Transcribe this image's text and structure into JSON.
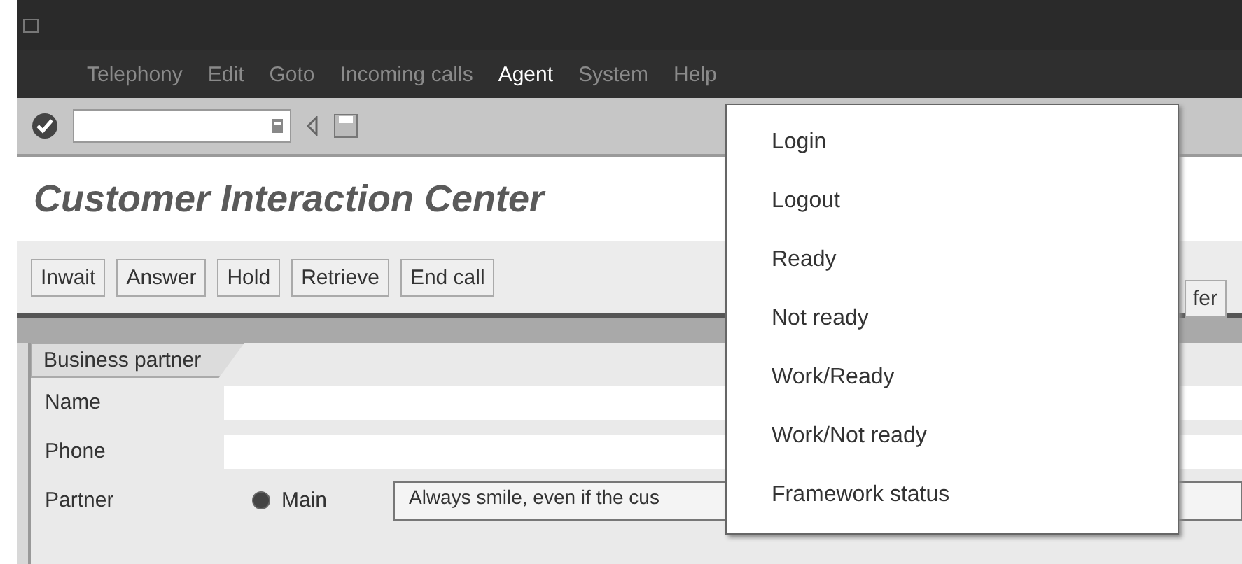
{
  "menubar": [
    {
      "label": "Telephony",
      "selected": false
    },
    {
      "label": "Edit",
      "selected": false
    },
    {
      "label": "Goto",
      "selected": false
    },
    {
      "label": "Incoming calls",
      "selected": false
    },
    {
      "label": "Agent",
      "selected": true
    },
    {
      "label": "System",
      "selected": false
    },
    {
      "label": "Help",
      "selected": false
    }
  ],
  "title": "Customer Interaction Center",
  "action_buttons": [
    "Inwait",
    "Answer",
    "Hold",
    "Retrieve",
    "End call"
  ],
  "cut_button": "fer",
  "panel": {
    "tab": "Business partner",
    "fields": [
      {
        "label": "Name"
      },
      {
        "label": "Phone"
      },
      {
        "label": "Partner"
      }
    ],
    "radio": {
      "label": "Main",
      "selected": true
    },
    "note": "Always smile, even if the cus"
  },
  "dropdown": [
    "Login",
    "Logout",
    "Ready",
    "Not ready",
    "Work/Ready",
    "Work/Not ready",
    "Framework status"
  ]
}
